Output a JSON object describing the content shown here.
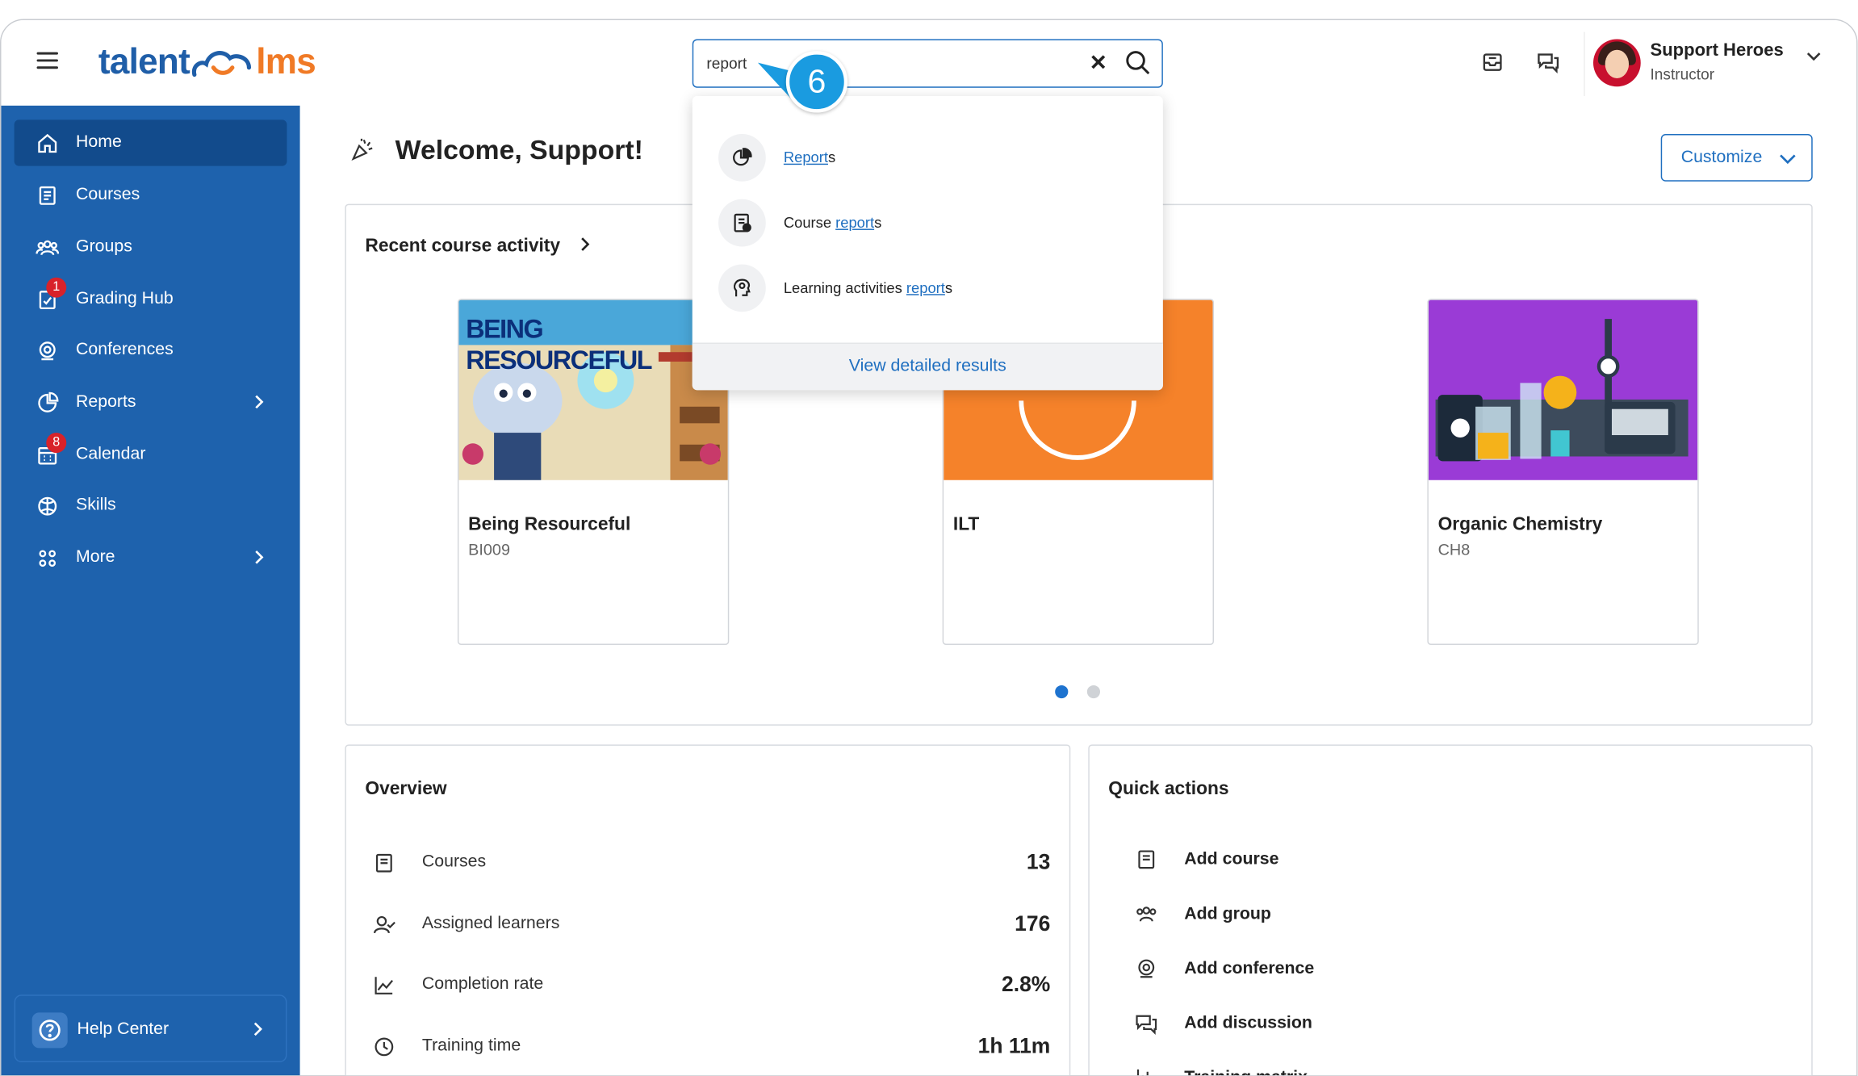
{
  "header": {
    "logo_left": "talent",
    "logo_right": "lms",
    "search_value": "report",
    "callout_number": "6",
    "user_name": "Support Heroes",
    "user_role": "Instructor"
  },
  "sidebar": {
    "items": [
      {
        "label": "Home",
        "icon": "home-icon"
      },
      {
        "label": "Courses",
        "icon": "courses-icon"
      },
      {
        "label": "Groups",
        "icon": "groups-icon"
      },
      {
        "label": "Grading Hub",
        "icon": "grading-icon",
        "badge": "1"
      },
      {
        "label": "Conferences",
        "icon": "conference-icon"
      },
      {
        "label": "Reports",
        "icon": "reports-icon"
      },
      {
        "label": "Calendar",
        "icon": "calendar-icon",
        "badge": "8"
      },
      {
        "label": "Skills",
        "icon": "skills-icon"
      },
      {
        "label": "More",
        "icon": "more-icon"
      }
    ],
    "help_label": "Help Center",
    "colors": {
      "bg": "#1e62ad",
      "active": "#124b8c"
    }
  },
  "main": {
    "welcome": "Welcome, Support!",
    "customize_label": "Customize",
    "recent_title": "Recent course activity",
    "courses": [
      {
        "title": "Being Resourceful",
        "code": "BI009",
        "banner": "BEING RESOURCEFUL"
      },
      {
        "title": "ILT",
        "code": ""
      },
      {
        "title": "Organic Chemistry",
        "code": "CH8"
      }
    ],
    "overview": {
      "title": "Overview",
      "rows": [
        {
          "label": "Courses",
          "value": "13"
        },
        {
          "label": "Assigned learners",
          "value": "176"
        },
        {
          "label": "Completion rate",
          "value": "2.8%"
        },
        {
          "label": "Training time",
          "value": "1h 11m"
        }
      ]
    },
    "quick_actions": {
      "title": "Quick actions",
      "items": [
        "Add course",
        "Add group",
        "Add conference",
        "Add discussion",
        "Training matrix"
      ]
    }
  },
  "dropdown": {
    "results": [
      {
        "prefix": "",
        "match": "Report",
        "suffix": "s"
      },
      {
        "prefix": "Course ",
        "match": "report",
        "suffix": "s"
      },
      {
        "prefix": "Learning activities ",
        "match": "report",
        "suffix": "s"
      }
    ],
    "footer": "View detailed results"
  }
}
